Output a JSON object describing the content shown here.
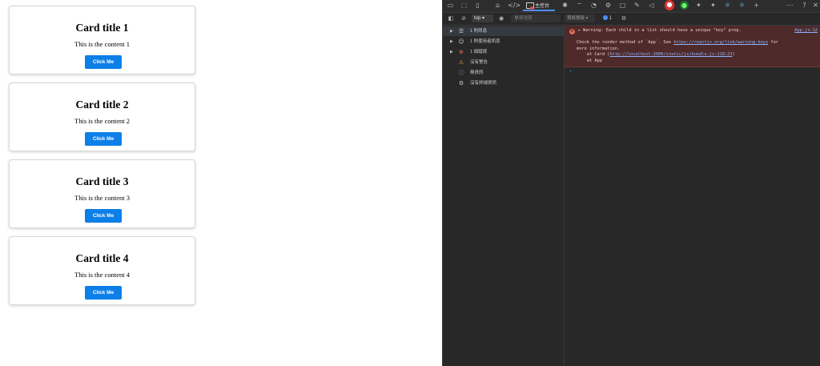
{
  "cards": [
    {
      "title": "Card title 1",
      "content": "This is the content 1",
      "button": "Click Me"
    },
    {
      "title": "Card title 2",
      "content": "This is the content 2",
      "button": "Click Me"
    },
    {
      "title": "Card title 3",
      "content": "This is the content 3",
      "button": "Click Me"
    },
    {
      "title": "Card title 4",
      "content": "This is the content 4",
      "button": "Click Me"
    }
  ],
  "devtools": {
    "console_tab": "主控台",
    "context": "top",
    "filter_placeholder": "篩選器",
    "levels": "預設層級",
    "issues_count": "1",
    "sidebar": [
      {
        "label": "1 則訊息",
        "icon": "list-icon"
      },
      {
        "label": "1 則使用者訊息",
        "icon": "user-icon"
      },
      {
        "label": "1 個錯誤",
        "icon": "error-icon"
      },
      {
        "label": "沒有警告",
        "icon": "warning-icon"
      },
      {
        "label": "無資訊",
        "icon": "info-icon"
      },
      {
        "label": "沒有詳細資訊",
        "icon": "verbose-icon"
      }
    ],
    "message": {
      "line1": "Warning: Each child in a list should have a unique \"key\" prop.",
      "source": "App.js:12",
      "line2_pre": "Check the render method of `App`. See ",
      "line2_link": "https://reactjs.org/link/warning-keys",
      "line2_post": " for",
      "line3": "more information.",
      "line4_pre": "    at Card (",
      "line4_link": "http://localhost:3000/static/js/bundle.js:118:23",
      "line4_post": ")",
      "line5": "    at App"
    },
    "accent_color": "#4f8ef7",
    "error_bg": "#4e2a2a"
  }
}
